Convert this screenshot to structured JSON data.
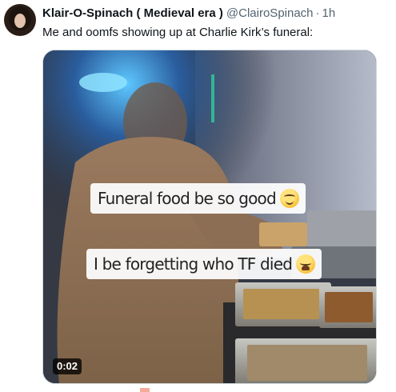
{
  "tweet": {
    "display_name": "Klair-O-Spinach ( Medieval era )",
    "handle": "@ClairoSpinach",
    "separator": "·",
    "time": "1h",
    "text": "Me and oomfs showing up at Charlie Kirk’s funeral:"
  },
  "video": {
    "captions": [
      {
        "text": "Funeral food be so good",
        "emoji": "face-savoring-food-emoji"
      },
      {
        "text": "I be forgetting who TF died",
        "emoji": "weary-face-emoji"
      }
    ],
    "duration": "0:02"
  },
  "colors": {
    "name": "#0f1419",
    "meta": "#536471",
    "border": "#cfd9de",
    "duration_bg": "#000000"
  }
}
